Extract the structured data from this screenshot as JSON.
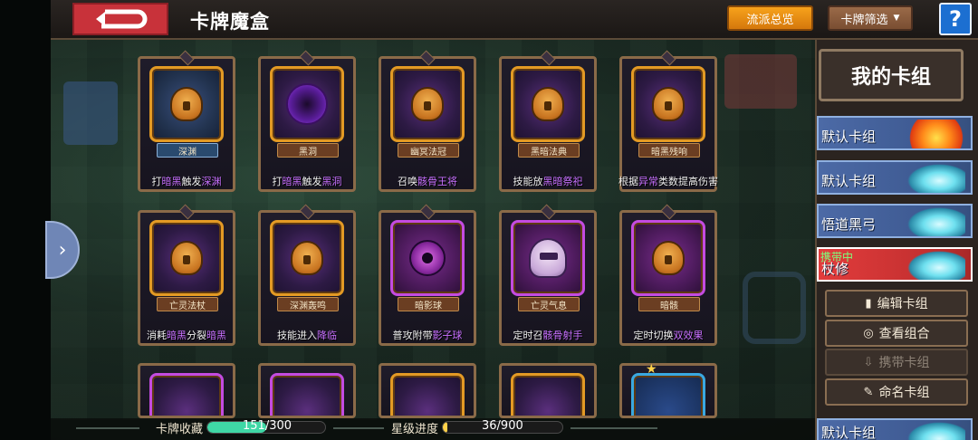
{
  "header": {
    "title": "卡牌魔盒",
    "school_overview_label": "流派总览",
    "card_filter_label": "卡牌筛选",
    "help_label": "?"
  },
  "cards": [
    {
      "name": "深渊",
      "desc_parts": [
        "打",
        "暗黑",
        "触发",
        "深渊"
      ],
      "style": "blue",
      "emblem": "lock"
    },
    {
      "name": "黑洞",
      "desc_parts": [
        "打",
        "暗黑",
        "触发",
        "黑洞"
      ],
      "style": "",
      "emblem": "void"
    },
    {
      "name": "幽冥法冠",
      "desc_parts": [
        "召唤",
        "骸骨王将",
        "",
        ""
      ],
      "style": "",
      "emblem": "lock"
    },
    {
      "name": "黑暗法典",
      "desc_parts": [
        "技能放",
        "黑暗祭祀",
        "",
        ""
      ],
      "style": "",
      "emblem": "lock"
    },
    {
      "name": "暗黑残响",
      "desc_parts": [
        "根据",
        "异常",
        "类数提高伤害",
        ""
      ],
      "style": "",
      "emblem": "lock"
    },
    {
      "name": "亡灵法杖",
      "desc_parts": [
        "消耗",
        "暗黑",
        "分裂",
        "暗黑"
      ],
      "style": "",
      "emblem": "lock"
    },
    {
      "name": "深渊轰鸣",
      "desc_parts": [
        "技能进入",
        "降临",
        "",
        ""
      ],
      "style": "",
      "emblem": "lock"
    },
    {
      "name": "暗影球",
      "desc_parts": [
        "普攻附带",
        "影子球",
        "",
        ""
      ],
      "style": "magenta",
      "emblem": "orb"
    },
    {
      "name": "亡灵气息",
      "desc_parts": [
        "定时召",
        "骸骨射手",
        "",
        ""
      ],
      "style": "magenta",
      "emblem": "ghost"
    },
    {
      "name": "暗骸",
      "desc_parts": [
        "定时切换",
        "双效果",
        "",
        ""
      ],
      "style": "magenta",
      "emblem": "lock"
    }
  ],
  "sidebar": {
    "title": "我的卡组",
    "decks": [
      {
        "label": "默认卡组",
        "art": "fire"
      },
      {
        "label": "默认卡组",
        "art": "ice"
      },
      {
        "label": "悟道黑弓",
        "art": "ice"
      },
      {
        "label": "杖修",
        "art": "ice",
        "status": "携带中"
      }
    ],
    "actions": {
      "edit": "编辑卡组",
      "view": "查看组合",
      "carry": "携带卡组",
      "rename": "命名卡组"
    },
    "bottom_deck": {
      "label": "默认卡组",
      "art": "ice"
    }
  },
  "footer": {
    "collection_label": "卡牌收藏",
    "collection_value": "151/300",
    "collection_progress": 0.503,
    "star_label": "星级进度",
    "star_value": "36/900",
    "star_progress": 0.04
  },
  "colors": {
    "highlight_purple": "#c870ff",
    "highlight_yellow": "#ffd24a",
    "collection_bar": "#3fd8a6",
    "star_bar": "#ffd24a",
    "active_deck": "#e23c3c"
  }
}
